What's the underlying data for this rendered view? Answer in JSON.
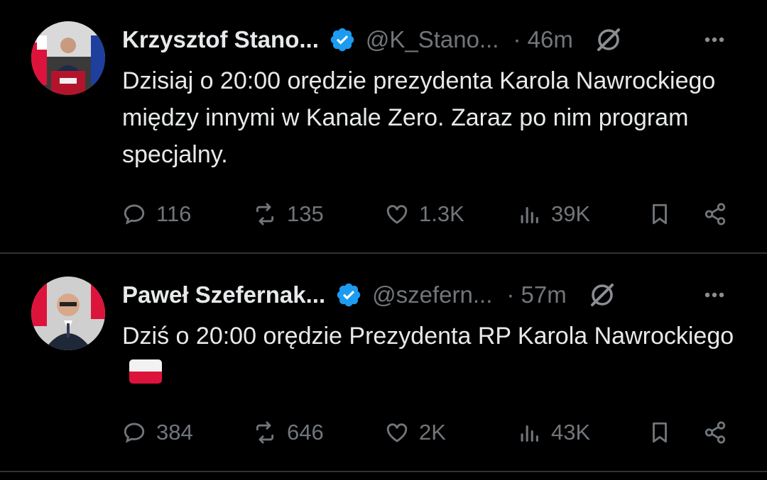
{
  "tweets": [
    {
      "name": "Krzysztof Stano...",
      "handle": "@K_Stano...",
      "time": "· 46m",
      "text": "Dzisiaj o 20:00 orędzie prezydenta Karola Nawrockiego między innymi w Kanale Zero. Zaraz po nim program specjalny.",
      "replies": "116",
      "reposts": "135",
      "likes": "1.3K",
      "views": "39K"
    },
    {
      "name": "Paweł Szefernak...",
      "handle": "@szefern...",
      "time": "· 57m",
      "text": "Dziś o 20:00 orędzie Prezydenta RP Karola Nawrockiego",
      "replies": "384",
      "reposts": "646",
      "likes": "2K",
      "views": "43K"
    }
  ],
  "icons": {
    "verified": "verified-badge-icon",
    "grok": "grok-icon",
    "more": "more-icon",
    "reply": "reply-icon",
    "repost": "repost-icon",
    "like": "like-icon",
    "views": "views-icon",
    "bookmark": "bookmark-icon",
    "share": "share-icon",
    "flag": "poland-flag-icon"
  },
  "colors": {
    "background": "#000000",
    "text": "#e7e9ea",
    "secondary": "#71767b",
    "verified": "#1d9bf0",
    "divider": "#2f3336"
  }
}
